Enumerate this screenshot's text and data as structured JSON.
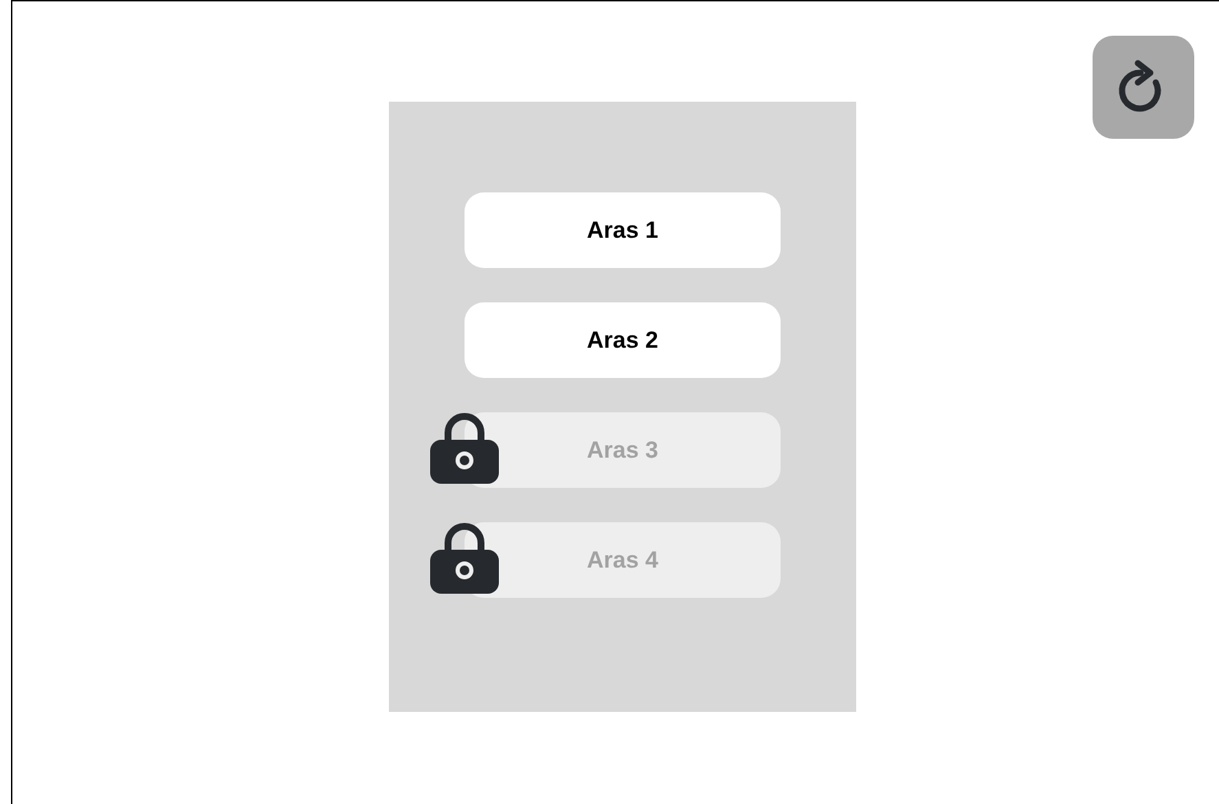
{
  "levels": [
    {
      "label": "Aras 1",
      "locked": false
    },
    {
      "label": "Aras 2",
      "locked": false
    },
    {
      "label": "Aras 3",
      "locked": true
    },
    {
      "label": "Aras 4",
      "locked": true
    }
  ]
}
